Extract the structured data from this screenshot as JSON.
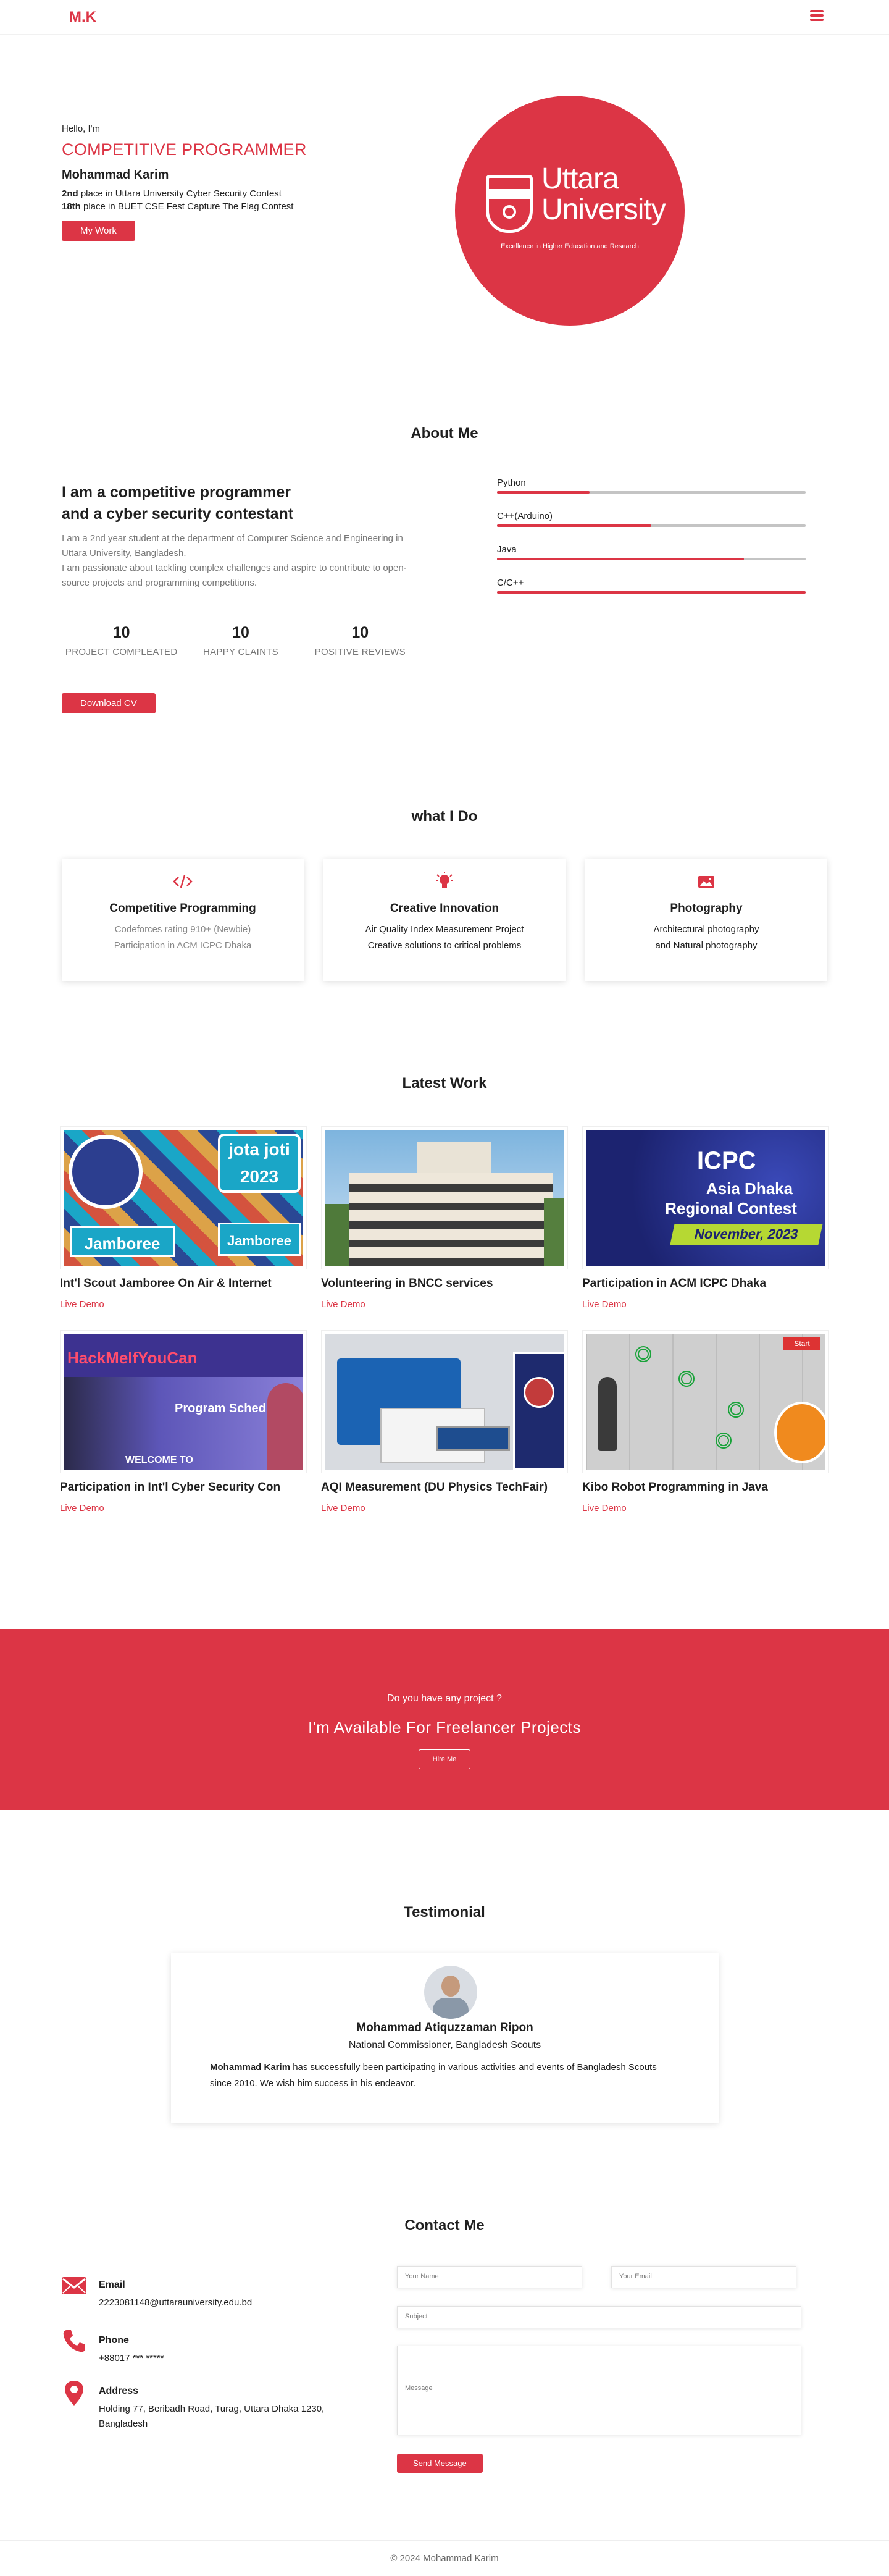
{
  "header": {
    "logo": "M.K",
    "menu_icon": "hamburger-menu-icon"
  },
  "hero": {
    "greeting": "Hello, I'm",
    "role": "COMPETITIVE PROGRAMMER",
    "name": "Mohammad Karim",
    "achievements": [
      {
        "rank": "2nd",
        "text": " place in Uttara University Cyber Security Contest"
      },
      {
        "rank": "18th",
        "text": " place in BUET CSE Fest Capture The Flag Contest"
      }
    ],
    "button": "My Work",
    "logo_name_1": "Uttara",
    "logo_name_2": "University",
    "logo_tagline": "Excellence in Higher Education and Research"
  },
  "about": {
    "title": "About Me",
    "heading_1": "I am a competitive programmer",
    "heading_2": "and a cyber security contestant",
    "para_1": "I am a 2nd year student at the department of Computer Science and Engineering in Uttara University, Bangladesh.",
    "para_2": "I am passionate about tackling complex challenges and aspire to contribute to open-source projects and programming competitions.",
    "stats": [
      {
        "num": "10",
        "label": "PROJECT COMPLEATED"
      },
      {
        "num": "10",
        "label": "HAPPY CLAINTS"
      },
      {
        "num": "10",
        "label": "POSITIVE REVIEWS"
      }
    ],
    "cv_button": "Download CV",
    "skills": [
      {
        "name": "Python",
        "level": 0.3
      },
      {
        "name": "C++(Arduino)",
        "level": 0.5
      },
      {
        "name": "Java",
        "level": 0.8
      },
      {
        "name": "C/C++",
        "level": 1.0
      }
    ]
  },
  "services": {
    "title": "what I Do",
    "items": [
      {
        "icon": "code-icon",
        "title": "Competitive Programming",
        "line_1": "Codeforces rating 910+ (Newbie)",
        "line_2": "Participation in ACM ICPC Dhaka"
      },
      {
        "icon": "lightbulb-icon",
        "title": "Creative Innovation",
        "line_1": "Air Quality Index Measurement Project",
        "line_2": "Creative solutions to critical problems"
      },
      {
        "icon": "image-icon",
        "title": "Photography",
        "line_1": "Architectural photography",
        "line_2": "and Natural photography"
      }
    ]
  },
  "works": {
    "title": "Latest Work",
    "demo_label": "Live Demo",
    "items": [
      {
        "title": "Int'l Scout Jamboree On Air & Internet",
        "img_text_1": "jota joti 2023",
        "img_text_2": "Jamboree"
      },
      {
        "title": "Volunteering in BNCC services",
        "img_text_1": "",
        "img_text_2": ""
      },
      {
        "title": "Participation in ACM ICPC Dhaka",
        "img_text_1": "ICPC",
        "img_text_2": "Asia Dhaka",
        "img_text_3": "Regional Contest",
        "img_text_4": "November, 2023"
      },
      {
        "title": "Participation in Int'l Cyber Security Con",
        "img_text_1": "HackMeIfYouCan",
        "img_text_2": "Program Schedule",
        "img_text_3": "WELCOME TO"
      },
      {
        "title": "AQI Measurement (DU Physics TechFair)",
        "img_text_1": "",
        "img_text_2": ""
      },
      {
        "title": "Kibo Robot Programming in Java",
        "img_text_1": "Start",
        "img_text_2": ""
      }
    ]
  },
  "freelance": {
    "question": "Do you have any project ?",
    "headline": "I'm Available For Freelancer Projects",
    "button": "Hire Me"
  },
  "testimonial": {
    "title": "Testimonial",
    "name": "Mohammad Atiquzzaman Ripon",
    "position": "National Commissioner, Bangladesh Scouts",
    "subject": "Mohammad Karim",
    "text": " has successfully been  participating in various activities and events of Bangladesh Scouts since 2010. We wish him success in his endeavor."
  },
  "contact": {
    "title": "Contact Me",
    "items": [
      {
        "icon": "envelope-icon",
        "label": "Email",
        "value": "2223081148@uttarauniversity.edu.bd"
      },
      {
        "icon": "phone-icon",
        "label": "Phone",
        "value": "+88017 *** *****"
      },
      {
        "icon": "location-pin-icon",
        "label": "Address",
        "value": "Holding 77, Beribadh Road, Turag, Uttara Dhaka 1230, Bangladesh"
      }
    ],
    "placeholders": {
      "name": "Your Name",
      "email": "Your Email",
      "subject": "Subject",
      "message": "Message"
    },
    "send_button": "Send Message"
  },
  "footer": {
    "text": "© 2024 Mohammad Karim"
  },
  "colors": {
    "accent": "#dc3545",
    "muted_text": "#777777",
    "bar_track": "#c4c4c4"
  }
}
